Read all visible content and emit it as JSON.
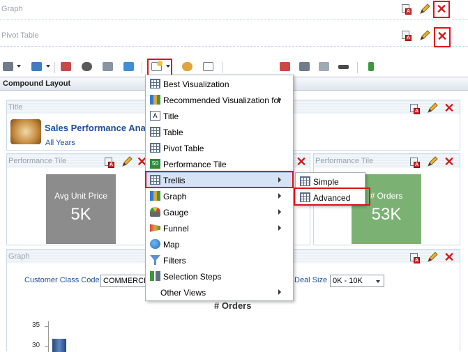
{
  "views": {
    "graph_label": "Graph",
    "pivot_label": "Pivot Table"
  },
  "compound": {
    "title": "Compound Layout"
  },
  "title_panel": {
    "header": "Title",
    "main_title": "Sales Performance Anal",
    "subtitle": "All Years"
  },
  "tile_left": {
    "header": "Performance Tile",
    "label": "Avg Unit Price",
    "value": "5K",
    "color": "#8c8c8c"
  },
  "tile_right": {
    "header": "Performance Tile",
    "label": "# Orders",
    "value": "53K",
    "color": "#7bb274"
  },
  "graph_panel": {
    "header": "Graph",
    "filter1_label": "Customer Class Code",
    "filter1_value": "COMMERCIA",
    "filter2_label": "Deal Size",
    "filter2_value": "0K - 10K",
    "chart_title": "# Orders",
    "tick_35": "35",
    "tick_30": "30"
  },
  "menu": {
    "items": [
      {
        "label": "Best Visualization"
      },
      {
        "label": "Recommended Visualization for"
      },
      {
        "label": "Title"
      },
      {
        "label": "Table"
      },
      {
        "label": "Pivot Table"
      },
      {
        "label": "Performance Tile"
      },
      {
        "label": "Trellis"
      },
      {
        "label": "Graph"
      },
      {
        "label": "Gauge"
      },
      {
        "label": "Funnel"
      },
      {
        "label": "Map"
      },
      {
        "label": "Filters"
      },
      {
        "label": "Selection Steps"
      },
      {
        "label": "Other Views"
      }
    ]
  },
  "submenu": {
    "simple": "Simple",
    "advanced": "Advanced"
  },
  "colors": {
    "highlight_red": "#e0101a",
    "menu_selected": "#d5e3f4",
    "link_blue": "#1a4f9c"
  }
}
